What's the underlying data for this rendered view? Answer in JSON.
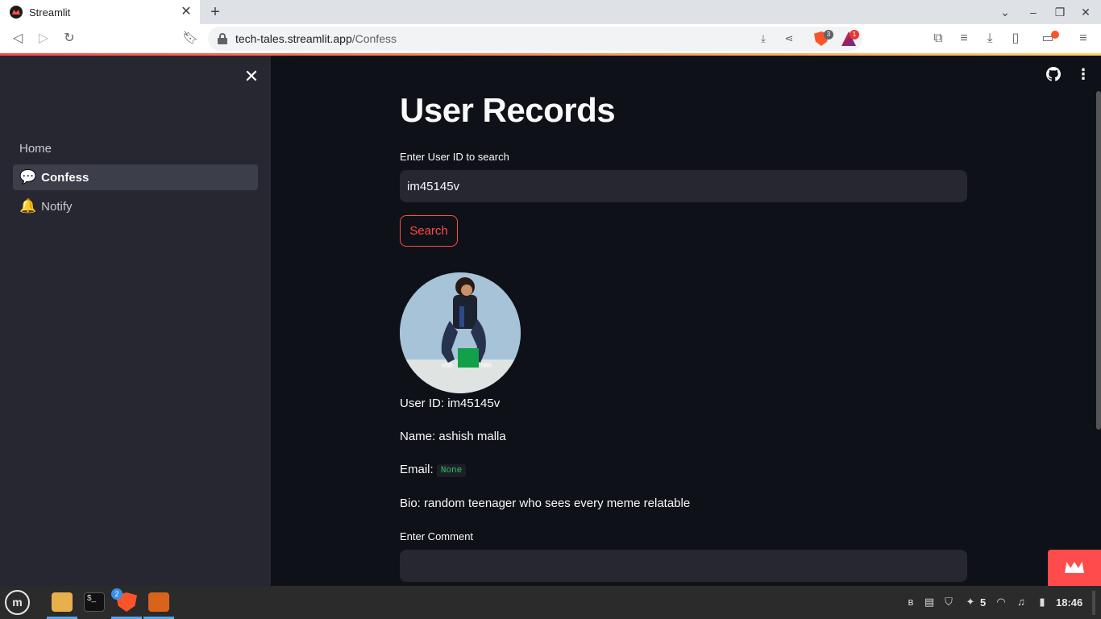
{
  "browser": {
    "tab_title": "Streamlit",
    "tab_close": "✕",
    "new_tab": "+",
    "url_host": "tech-tales.streamlit.app",
    "url_path": "/Confess",
    "shield_badge": "3",
    "rewards_badge": "1",
    "window_minimize": "–",
    "window_maximize": "❐",
    "window_close": "✕",
    "tab_search": "⌄"
  },
  "sidebar": {
    "close_icon": "✕",
    "items": [
      {
        "emoji": "",
        "label": "Home",
        "active": false
      },
      {
        "emoji": "💬",
        "label": "Confess",
        "active": true
      },
      {
        "emoji": "🔔",
        "label": "Notify",
        "active": false
      }
    ]
  },
  "main": {
    "title": "User Records",
    "search_label": "Enter User ID to search",
    "search_value": "im45145v",
    "search_button": "Search",
    "user": {
      "id_prefix": "User ID: ",
      "id": "im45145v",
      "name_prefix": "Name: ",
      "name": "ashish malla",
      "email_prefix": "Email: ",
      "email": "None",
      "bio_prefix": "Bio: ",
      "bio": "random teenager who sees every meme relatable"
    },
    "comment_label": "Enter Comment",
    "comment_value": "",
    "menu_icon": "⋮"
  },
  "taskbar": {
    "browser_count": "2",
    "tray_number": "5",
    "clock": "18:46"
  },
  "colors": {
    "accent": "#ff4b4b",
    "background": "#0e1117",
    "sidebar": "#262730",
    "code_green": "#2ec26b"
  },
  "icons": {
    "github": "github-icon",
    "menu": "kebab-menu-icon",
    "crown": "streamlit-crown-icon"
  }
}
